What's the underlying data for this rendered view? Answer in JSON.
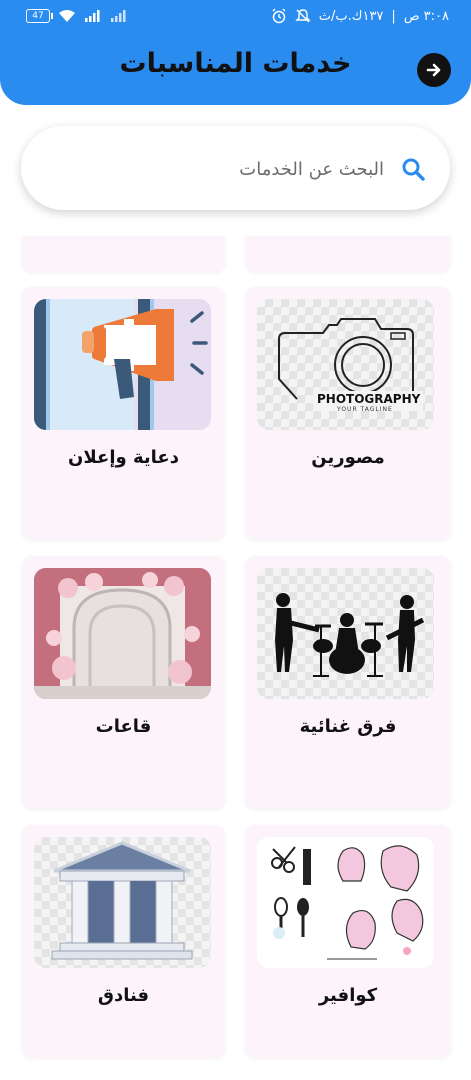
{
  "status_bar": {
    "battery": "47",
    "time": "٣:٠٨ ص",
    "network_speed": "١٣٧ك.ب/ث"
  },
  "header": {
    "title": "خدمات المناسبات",
    "forward_icon": "arrow-right-icon"
  },
  "search": {
    "placeholder": "البحث عن الخدمات",
    "icon": "search-icon"
  },
  "services": [
    {
      "label": "مصورين",
      "image": "photography-camera-logo"
    },
    {
      "label": "دعاية وإعلان",
      "image": "megaphone"
    },
    {
      "label": "فرق غنائية",
      "image": "band-silhouette"
    },
    {
      "label": "قاعات",
      "image": "floral-hall-arch"
    },
    {
      "label": "كوافير",
      "image": "hair-salon-tools"
    },
    {
      "label": "فنادق",
      "image": "columns-building"
    }
  ],
  "photography_logo": {
    "title": "PHOTOGRAPHY",
    "tagline": "YOUR TAGLINE"
  },
  "colors": {
    "app_bar": "#2b8cef",
    "card_bg": "#fdf3fb",
    "search_icon": "#2b8cef"
  }
}
